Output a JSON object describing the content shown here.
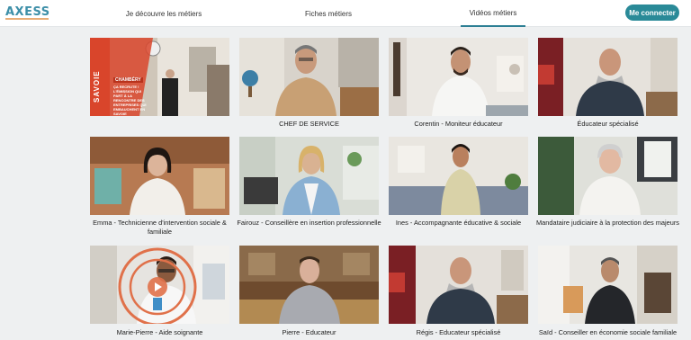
{
  "header": {
    "logo_text": "AXESS",
    "nav": [
      {
        "label": "Je découvre les métiers",
        "active": false
      },
      {
        "label": "Fiches métiers",
        "active": false
      },
      {
        "label": "Vidéos métiers",
        "active": true
      }
    ],
    "connect_label": "Me connecter"
  },
  "videos": [
    {
      "caption": "",
      "overlay": {
        "tag": "CHAMBÉRY",
        "vertical": "SAVOIE",
        "text": "ÇA RECRUTE ! L'ÉMISSION QUI PART À LA RENCONTRE DES ENTREPRISES QUI EMBAUCHENT EN SAVOIE"
      }
    },
    {
      "caption": "CHEF DE SERVICE"
    },
    {
      "caption": "Corentin - Moniteur éducateur"
    },
    {
      "caption": "Éducateur spécialisé"
    },
    {
      "caption": "Emma - Technicienne d'intervention sociale & familiale"
    },
    {
      "caption": "Fairouz - Conseillère en insertion professionnelle"
    },
    {
      "caption": "Ines - Accompagnante éducative & sociale"
    },
    {
      "caption": "Mandataire judiciaire à la protection des majeurs"
    },
    {
      "caption": "Marie-Pierre - Aide soignante"
    },
    {
      "caption": "Pierre - Educateur"
    },
    {
      "caption": "Régis - Educateur spécialisé"
    },
    {
      "caption": "Saïd - Conseiller en économie sociale familiale"
    }
  ],
  "colors": {
    "accent": "#2a8a98",
    "overlay_red": "#d9452b",
    "ring": "#e0714a"
  }
}
